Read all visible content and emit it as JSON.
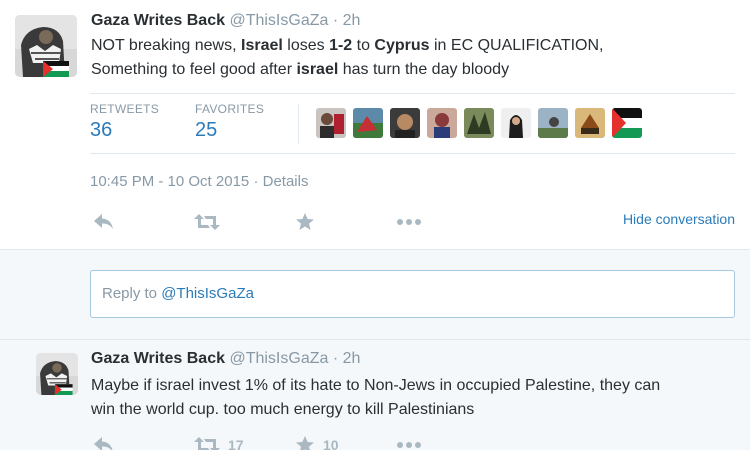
{
  "main_tweet": {
    "fullname": "Gaza Writes Back",
    "handle": "@ThisIsGaZa",
    "dot": "·",
    "time": "2h",
    "text": {
      "t1": "NOT breaking news, ",
      "b1": "Israel",
      "t2": " loses ",
      "b2": "1-2",
      "t3": " to ",
      "b3": "Cyprus",
      "t4": " in EC QUALIFICATION,",
      "t5": "Something to feel good after ",
      "b4": "israel",
      "t6": " has turn the day bloody"
    },
    "stats": {
      "retweets_label": "RETWEETS",
      "retweets_value": "36",
      "favorites_label": "FAVORITES",
      "favorites_value": "25"
    },
    "meta": {
      "timestamp": "10:45 PM - 10 Oct 2015",
      "separator": "·",
      "details": "Details"
    },
    "actions": {
      "reply_icon": "reply-icon",
      "retweet_icon": "retweet-icon",
      "favorite_icon": "star-icon",
      "more_icon": "more-icon",
      "hide_conversation": "Hide conversation"
    }
  },
  "reply_composer": {
    "prefix": "Reply to ",
    "mention": "@ThisIsGaZa"
  },
  "reply_tweet": {
    "fullname": "Gaza Writes Back",
    "handle": "@ThisIsGaZa",
    "dot": "·",
    "time": "2h",
    "line1": "Maybe if israel invest 1% of its hate to Non-Jews in occupied Palestine, they can",
    "line2": "win the world cup. too much energy to kill Palestinians",
    "retweet_count": "17",
    "favorite_count": "10"
  },
  "colors": {
    "link": "#2b7bb9",
    "muted": "#8899a6",
    "icon": "#aab8c2",
    "text": "#292f33",
    "reply_bg": "#f5f8fa"
  }
}
